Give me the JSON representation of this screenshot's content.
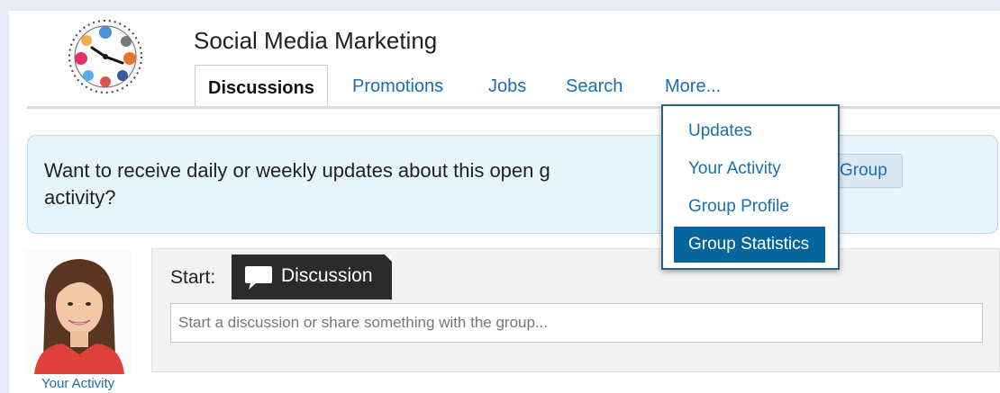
{
  "group": {
    "title": "Social Media Marketing"
  },
  "tabs": [
    {
      "label": "Discussions",
      "active": true
    },
    {
      "label": "Promotions"
    },
    {
      "label": "Jobs"
    },
    {
      "label": "Search"
    },
    {
      "label": "More..."
    }
  ],
  "more_menu": {
    "items": [
      {
        "label": "Updates"
      },
      {
        "label": "Your Activity"
      },
      {
        "label": "Group Profile"
      },
      {
        "label": "Group Statistics",
        "active": true
      }
    ]
  },
  "notice": {
    "text": "Want to receive daily or weekly updates about this open g",
    "text_line2": "activity?",
    "button_label": "Group"
  },
  "composer": {
    "start_label": "Start:",
    "type_label": "Discussion",
    "placeholder": "Start a discussion or share something with the group..."
  },
  "user": {
    "caption": "Your Activity"
  },
  "icons": {
    "logo": "clock-social-logo-icon",
    "discussion": "speech-bubble-icon"
  },
  "colors": {
    "link": "#1a6fb0",
    "menu_highlight": "#05659c",
    "notice_bg": "#e8f4fb",
    "badge_bg": "#2b2b2b"
  }
}
